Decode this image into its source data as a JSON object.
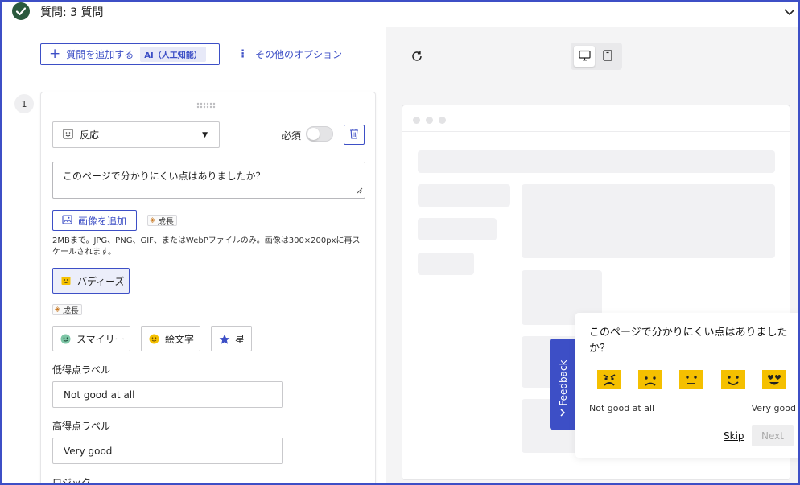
{
  "header": {
    "title": "質問: 3 質問"
  },
  "toolbar": {
    "add_question_label": "質問を追加する",
    "ai_badge": "AI（人工知能）",
    "other_options_label": "その他のオプション"
  },
  "question": {
    "number": "1",
    "type_label": "反応",
    "required_label": "必須",
    "required_on": false,
    "text": "このページで分かりにくい点はありましたか？",
    "add_image_label": "画像を追加",
    "growth_badge": "成長",
    "image_help": "2MBまで。JPG、PNG、GIF、またはWebPファイルのみ。画像は300×200pxに再スケールされます。",
    "buddies_label": "バディーズ",
    "growth_badge_2": "成長",
    "styles": [
      {
        "label": "スマイリー",
        "icon": "smiley-icon"
      },
      {
        "label": "絵文字",
        "icon": "emoji-icon"
      },
      {
        "label": "星",
        "icon": "star-icon"
      }
    ],
    "low_label_heading": "低得点ラベル",
    "low_label_value": "Not good at all",
    "high_label_heading": "高得点ラベル",
    "high_label_value": "Very good",
    "logic_heading": "ロジック"
  },
  "preview": {
    "feedback_tab": "Feedback",
    "question": "このページで分かりにくい点はありましたか？",
    "low": "Not good at all",
    "high": "Very good",
    "skip": "Skip",
    "next": "Next",
    "accent": "#3d4fc6",
    "face_color": "#f5c000"
  }
}
